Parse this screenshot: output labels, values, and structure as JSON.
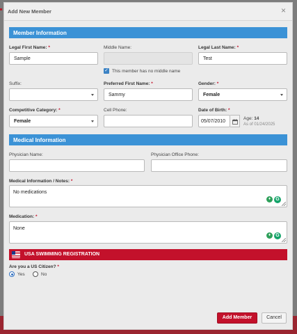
{
  "modal": {
    "title": "Add New Member",
    "close_symbol": "×"
  },
  "sections": {
    "member_info": "Member Information",
    "medical_info": "Medical Information",
    "usa_swimming": "USA SWIMMING REGISTRATION"
  },
  "fields": {
    "legal_first_name": {
      "label": "Legal First Name:",
      "value": "Sample",
      "required": true
    },
    "middle_name": {
      "label": "Middle Name:",
      "value": "",
      "required": false
    },
    "legal_last_name": {
      "label": "Legal Last Name:",
      "value": "Test",
      "required": true
    },
    "no_middle_name": {
      "label": "This member has no middle name",
      "checked": true
    },
    "suffix": {
      "label": "Suffix:",
      "value": ""
    },
    "preferred_first_name": {
      "label": "Preferred First Name:",
      "value": "Sammy",
      "required": true
    },
    "gender": {
      "label": "Gender:",
      "value": "Female",
      "required": true
    },
    "competitive_category": {
      "label": "Competitive Category:",
      "value": "Female",
      "required": true
    },
    "cell_phone": {
      "label": "Cell Phone:",
      "value": ""
    },
    "date_of_birth": {
      "label": "Date of Birth:",
      "value": "05/07/2010",
      "required": true
    },
    "age": {
      "label": "Age:",
      "value": "14",
      "as_of": "As of 01/24/2025"
    },
    "physician_name": {
      "label": "Physician Name:",
      "value": ""
    },
    "physician_phone": {
      "label": "Physician Office Phone:",
      "value": ""
    },
    "medical_notes": {
      "label": "Medical Information / Notes:",
      "value": "No medications",
      "required": true
    },
    "medication": {
      "label": "Medication:",
      "value": "None",
      "required": true
    },
    "us_citizen": {
      "label": "Are you a US Citizen?",
      "required": true,
      "options": [
        "Yes",
        "No"
      ],
      "selected": "Yes"
    }
  },
  "required_mark": "*",
  "grammarly_glyph": "G",
  "buttons": {
    "add_member": "Add Member",
    "cancel": "Cancel"
  },
  "colors": {
    "section_blue": "#3b92d6",
    "usa_red": "#c3112b"
  },
  "icons": [
    "close-icon",
    "checkbox-checked-icon",
    "chevron-down-icon",
    "calendar-icon",
    "lightbulb-icon",
    "grammarly-icon",
    "usa-swimming-flag-icon"
  ]
}
